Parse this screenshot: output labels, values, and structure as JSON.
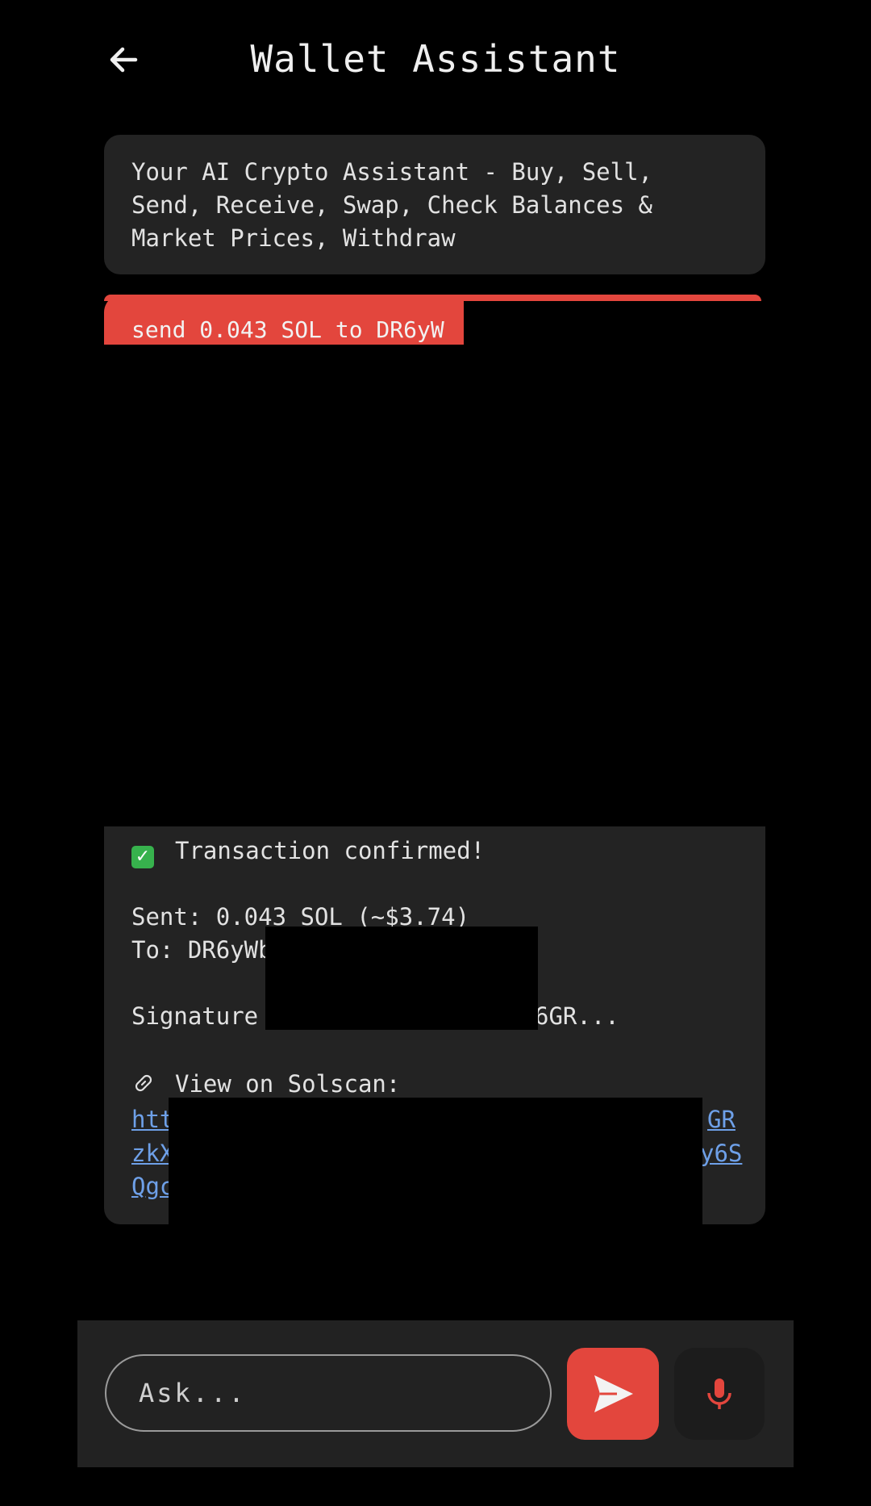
{
  "header": {
    "title": "Wallet Assistant",
    "back_icon": "arrow-left-icon"
  },
  "messages": {
    "intro": "Your AI Crypto Assistant - Buy, Sell,\nSend, Receive, Swap, Check Balances &\nMarket Prices, Withdraw",
    "user": "send 0.043 SOL to DR6yW",
    "confirmation": {
      "status_icon": "checkmark-icon",
      "status": "Transaction confirmed!",
      "sent": "Sent: 0.043 SOL (~$3.74)",
      "to": "To: DR6yWb",
      "signature_start": "Signature",
      "signature_end": "6GR...",
      "link_icon": "link-icon",
      "view_label": "View on Solscan:",
      "url_line1_start": "htt",
      "url_line1_end": "GR",
      "url_line2_start": "zkX",
      "url_line2_end": "y6S",
      "url_line3_start": "Qgc"
    }
  },
  "input": {
    "placeholder": "Ask...",
    "send_icon": "send-icon",
    "mic_icon": "microphone-icon"
  },
  "colors": {
    "accent": "#e3463d",
    "card": "#232323",
    "link": "#6ea0e8",
    "check": "#37b24d"
  }
}
